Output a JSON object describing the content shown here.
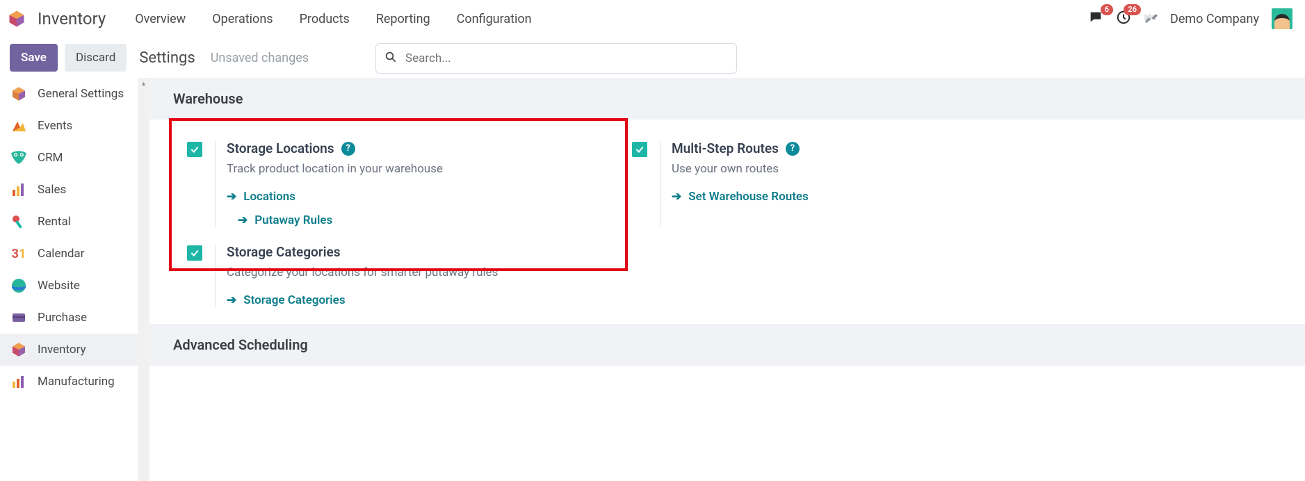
{
  "header": {
    "app_title": "Inventory",
    "nav": [
      "Overview",
      "Operations",
      "Products",
      "Reporting",
      "Configuration"
    ],
    "messages_badge": "6",
    "activities_badge": "26",
    "company": "Demo Company"
  },
  "controlbar": {
    "save": "Save",
    "discard": "Discard",
    "breadcrumb": "Settings",
    "status": "Unsaved changes",
    "search_placeholder": "Search..."
  },
  "sidebar": {
    "items": [
      {
        "label": "General Settings"
      },
      {
        "label": "Events"
      },
      {
        "label": "CRM"
      },
      {
        "label": "Sales"
      },
      {
        "label": "Rental"
      },
      {
        "label": "Calendar"
      },
      {
        "label": "Website"
      },
      {
        "label": "Purchase"
      },
      {
        "label": "Inventory",
        "active": true
      },
      {
        "label": "Manufacturing"
      }
    ]
  },
  "sections": {
    "warehouse": {
      "title": "Warehouse",
      "storage_locations": {
        "title": "Storage Locations",
        "desc": "Track product location in your warehouse",
        "link_locations": "Locations",
        "link_putaway": "Putaway Rules"
      },
      "multi_step": {
        "title": "Multi-Step Routes",
        "desc": "Use your own routes",
        "link_routes": "Set Warehouse Routes"
      },
      "storage_categories": {
        "title": "Storage Categories",
        "desc": "Categorize your locations for smarter putaway rules",
        "link_categories": "Storage Categories"
      }
    },
    "advanced": {
      "title": "Advanced Scheduling"
    }
  }
}
